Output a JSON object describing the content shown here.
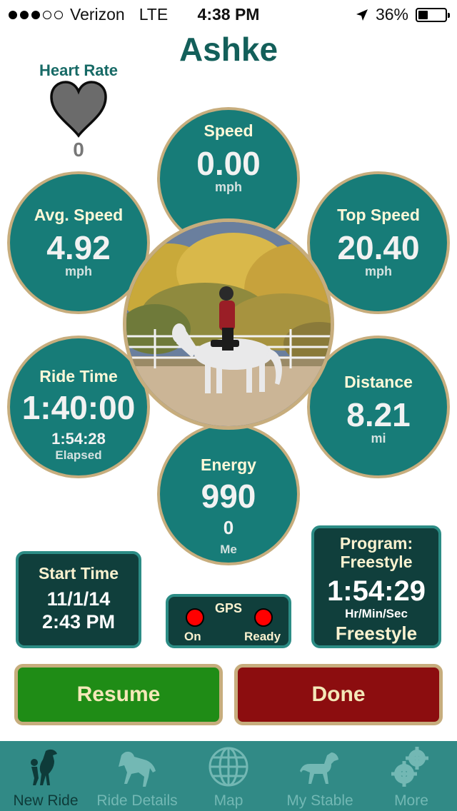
{
  "status": {
    "carrier": "Verizon",
    "network": "LTE",
    "time": "4:38 PM",
    "battery": "36%",
    "battery_level": 0.36,
    "signal_bars": 3,
    "signal_total": 5
  },
  "title": "Ashke",
  "heart_rate": {
    "label": "Heart Rate",
    "value": "0"
  },
  "stats": {
    "speed": {
      "label": "Speed",
      "value": "0.00",
      "unit": "mph"
    },
    "avg_speed": {
      "label": "Avg. Speed",
      "value": "4.92",
      "unit": "mph"
    },
    "top_speed": {
      "label": "Top Speed",
      "value": "20.40",
      "unit": "mph"
    },
    "ride_time": {
      "label": "Ride Time",
      "value": "1:40:00",
      "elapsed_value": "1:54:28",
      "elapsed_label": "Elapsed"
    },
    "distance": {
      "label": "Distance",
      "value": "8.21",
      "unit": "mi"
    },
    "energy": {
      "label": "Energy",
      "value": "990",
      "sub_value": "0",
      "sub_label": "Me"
    }
  },
  "start_time": {
    "label": "Start Time",
    "date": "11/1/14",
    "time": "2:43 PM"
  },
  "gps": {
    "label": "GPS",
    "left_status": "On",
    "right_status": "Ready",
    "indicator_color": "#ff0000"
  },
  "program": {
    "label_line1": "Program:",
    "label_line2": "Freestyle",
    "time": "1:54:29",
    "time_unit": "Hr/Min/Sec",
    "name": "Freestyle"
  },
  "buttons": {
    "resume": "Resume",
    "done": "Done"
  },
  "colors": {
    "teal": "#177c78",
    "gold_border": "#c7ad7d",
    "dark_box": "#103f3c",
    "resume_green": "#1f8c16",
    "done_red": "#8c0d0f",
    "tabbar": "#318a86"
  },
  "tabs": [
    {
      "label": "New Ride",
      "icon": "horse-rearing-icon",
      "active": true
    },
    {
      "label": "Ride Details",
      "icon": "horse-leaping-icon",
      "active": false
    },
    {
      "label": "Map",
      "icon": "globe-icon",
      "active": false
    },
    {
      "label": "My Stable",
      "icon": "horse-trotting-icon",
      "active": false
    },
    {
      "label": "More",
      "icon": "gears-icon",
      "active": false
    }
  ]
}
